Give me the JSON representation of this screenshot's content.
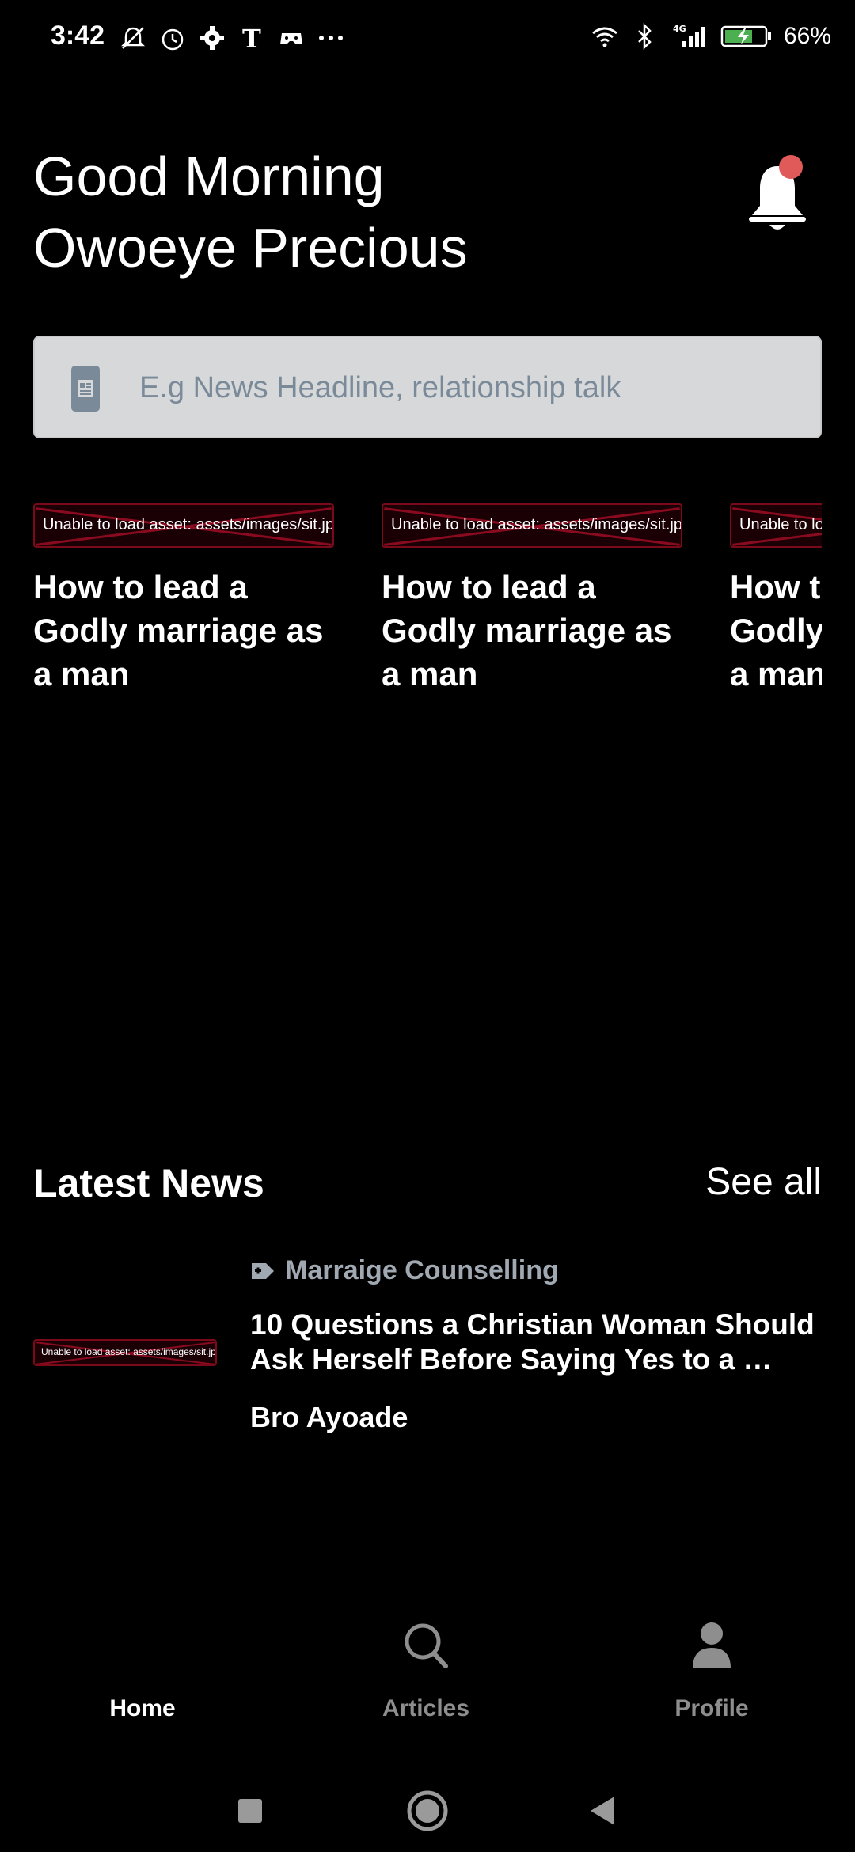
{
  "status_bar": {
    "time": "3:42",
    "battery_percent": "66%",
    "network": "4G",
    "icons_left": [
      "mute-icon",
      "alarm-icon",
      "gear-icon",
      "nyt-icon",
      "game-icon",
      "more-icon"
    ],
    "icons_right": [
      "wifi-icon",
      "bluetooth-icon",
      "signal-icon",
      "battery-icon"
    ]
  },
  "header": {
    "greeting_line1": "Good Morning",
    "greeting_line2": "Owoeye Precious",
    "notification_dot_color": "#e05a5a"
  },
  "search": {
    "placeholder": "E.g News Headline, relationship talk",
    "value": ""
  },
  "carousel": {
    "items": [
      {
        "image_error": "Unable to load asset: assets/images/sit.jpg",
        "title": "How to lead a Godly marriage as a man"
      },
      {
        "image_error": "Unable to load asset: assets/images/sit.jpg",
        "title": "How to lead a Godly marriage as a man"
      },
      {
        "image_error": "Unable to load asset: assets/images/sit.jpg",
        "title": "How to lead a Godly marriage as a man"
      }
    ]
  },
  "latest_news": {
    "title": "Latest News",
    "see_all": "See all",
    "items": [
      {
        "image_error": "Unable to load asset: assets/images/sit.jpg",
        "category": "Marraige Counselling",
        "title": "10 Questions a Christian Woman Should Ask Herself Before Saying Yes to a …",
        "author": "Bro Ayoade"
      }
    ]
  },
  "bottom_nav": {
    "items": [
      {
        "label": "Home",
        "active": true
      },
      {
        "label": "Articles",
        "active": false
      },
      {
        "label": "Profile",
        "active": false
      }
    ]
  }
}
